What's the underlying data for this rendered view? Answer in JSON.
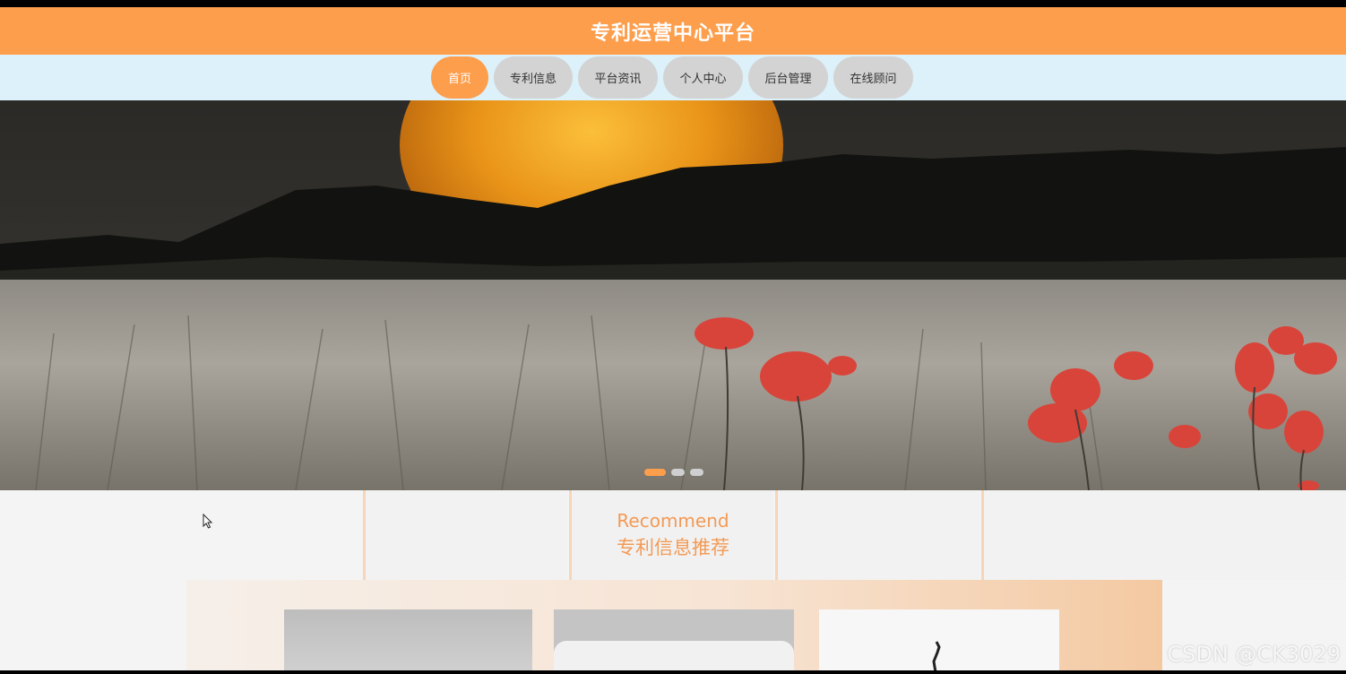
{
  "header": {
    "title": "专利运营中心平台"
  },
  "nav": {
    "items": [
      {
        "label": "首页",
        "active": true
      },
      {
        "label": "专利信息",
        "active": false
      },
      {
        "label": "平台资讯",
        "active": false
      },
      {
        "label": "个人中心",
        "active": false
      },
      {
        "label": "后台管理",
        "active": false
      },
      {
        "label": "在线顾问",
        "active": false
      }
    ]
  },
  "banner": {
    "image": "moon-poppy-field-photo",
    "slides": 3,
    "active_slide": 1
  },
  "recommend": {
    "title_en": "Recommend",
    "title_cn": "专利信息推荐"
  },
  "watermark": "CSDN @CK3029",
  "colors": {
    "accent": "#fd9e4d",
    "nav_bg": "#dcf1f9",
    "nav_item": "#d3d3d3",
    "recommend_text": "#f39a55"
  }
}
